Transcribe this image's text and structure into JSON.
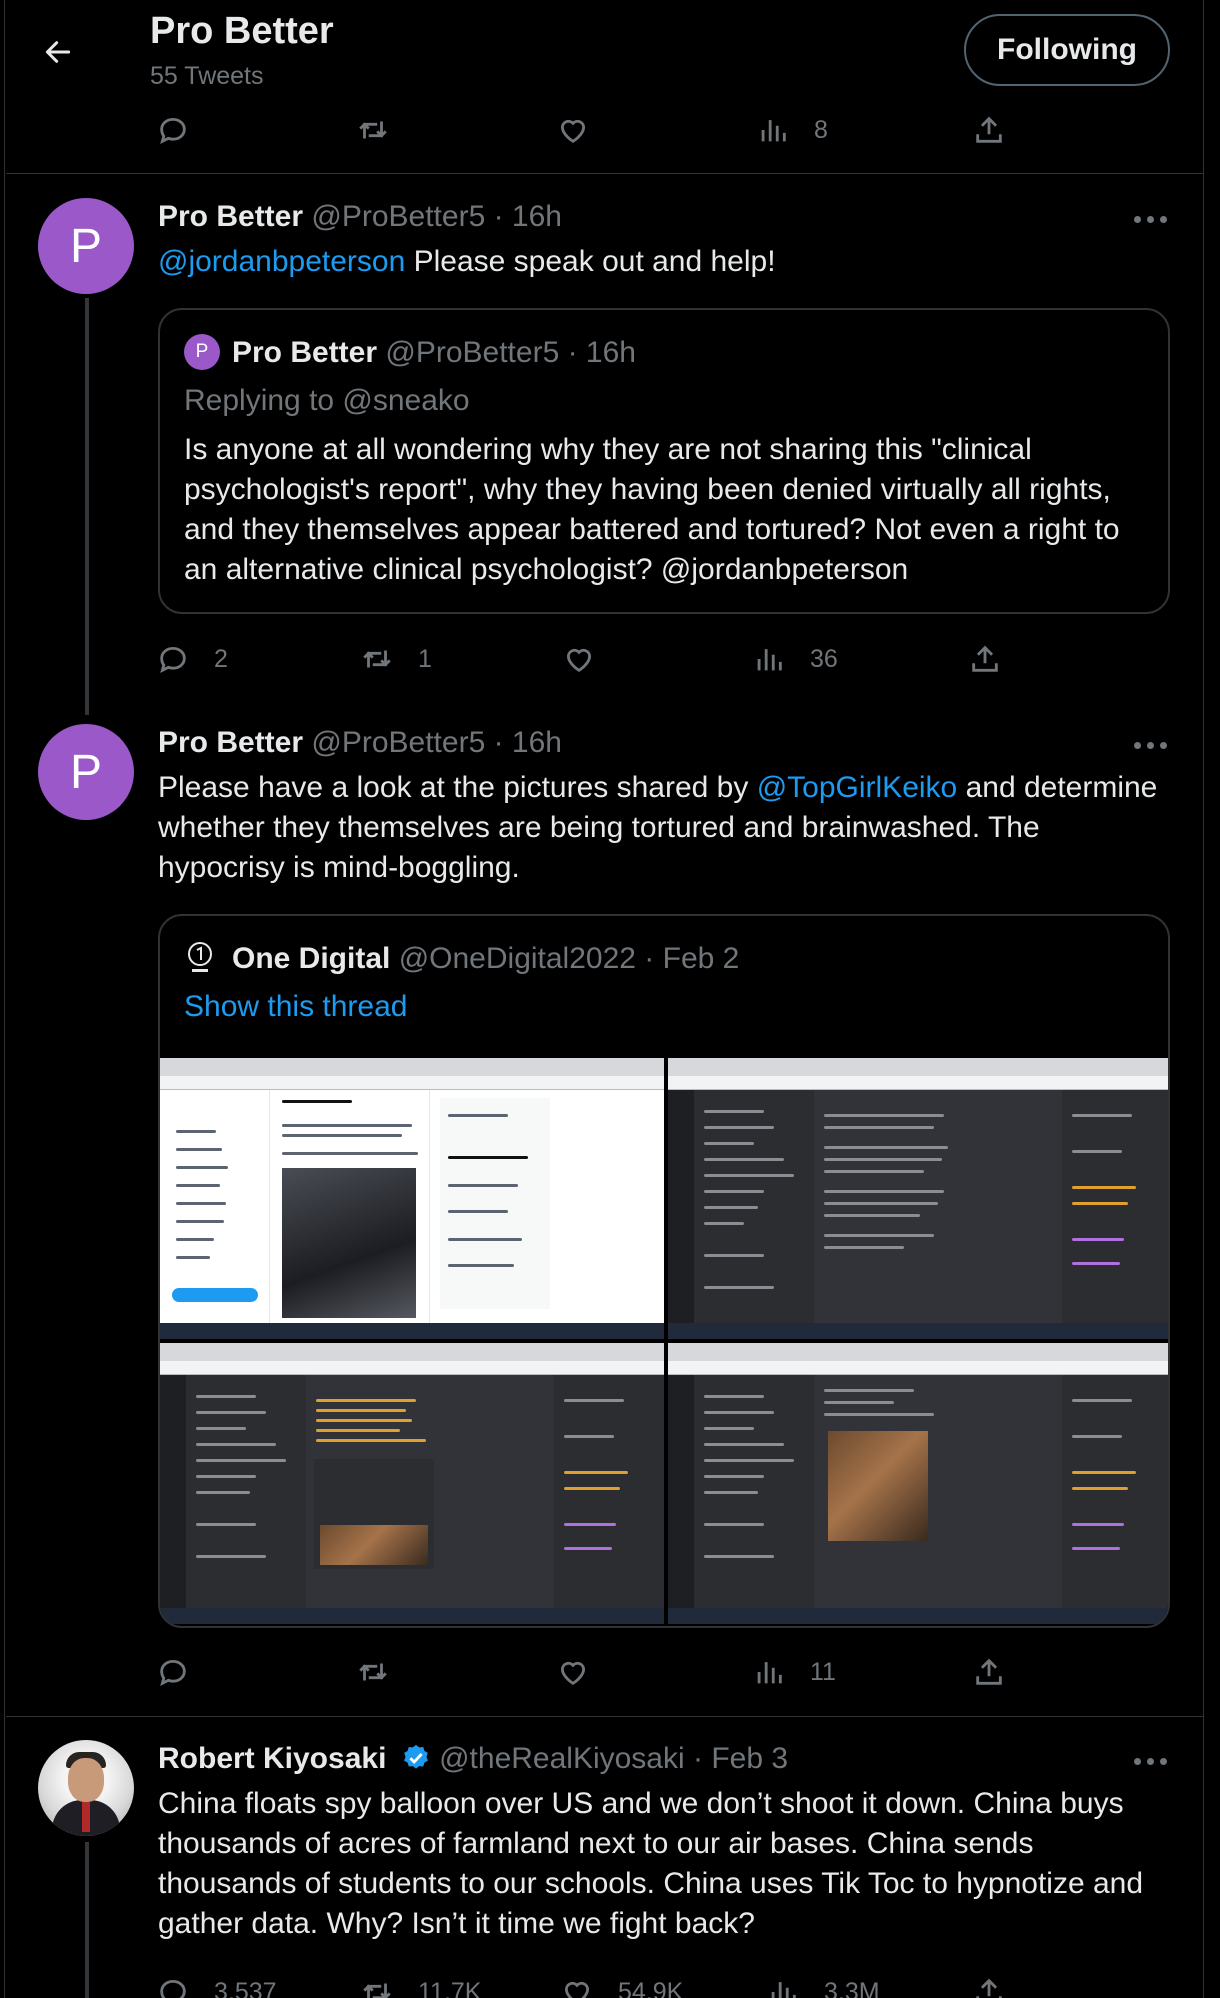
{
  "header": {
    "back_label": "Back",
    "title": "Pro Better",
    "subtitle": "55 Tweets",
    "follow_label": "Following"
  },
  "top_actions": {
    "views": "8"
  },
  "tweet1": {
    "name": "Pro Better",
    "handle_time": "@ProBetter5 · 16h",
    "avatar_letter": "P",
    "mention": "@jordanbpeterson",
    "text": " Please speak out and help!",
    "quote": {
      "avatar_letter": "P",
      "name": "Pro Better",
      "handle_time": "@ProBetter5 · 16h",
      "replying": "Replying to @sneako",
      "text": "Is anyone at all wondering why they are not sharing this \"clinical psychologist's report\", why they having been denied virtually all rights, and they themselves appear battered and tortured?  Not even a right to an alternative clinical psychologist? @jordanbpeterson"
    },
    "actions": {
      "replies": "2",
      "retweets": "1",
      "likes": "",
      "views": "36"
    }
  },
  "tweet2": {
    "name": "Pro Better",
    "handle_time": "@ProBetter5 · 16h",
    "avatar_letter": "P",
    "text_before": "Please have a look at the pictures shared by ",
    "mention": "@TopGirlKeiko",
    "text_after": " and determine whether they themselves are being tortured and brainwashed. The hypocrisy is mind-boggling.",
    "quote": {
      "name": "One Digital",
      "handle_time": "@OneDigital2022 · Feb 2",
      "show_thread": "Show this thread"
    },
    "actions": {
      "views": "11"
    }
  },
  "tweet3": {
    "name": "Robert Kiyosaki",
    "handle_time": "@theRealKiyosaki · Feb 3",
    "text": "China floats spy balloon over US and we don’t shoot it down. China buys thousands of acres of farmland next to our air bases. China sends thousands of students to our schools. China uses Tik Toc to hypnotize and gather data. Why?  Isn’t it time we fight back?",
    "actions": {
      "replies": "3,537",
      "retweets": "11.7K",
      "likes": "54.9K",
      "views": "3.3M"
    }
  },
  "colors": {
    "background": "#000000",
    "text": "#e7e9ea",
    "muted": "#71767b",
    "link": "#1d9bf0",
    "avatar": "#9a58c9",
    "border": "#2f3336"
  },
  "icons": [
    "back-arrow-icon",
    "reply-icon",
    "retweet-icon",
    "like-icon",
    "views-icon",
    "share-icon",
    "more-icon",
    "verified-badge-icon",
    "one-digital-logo-icon"
  ]
}
